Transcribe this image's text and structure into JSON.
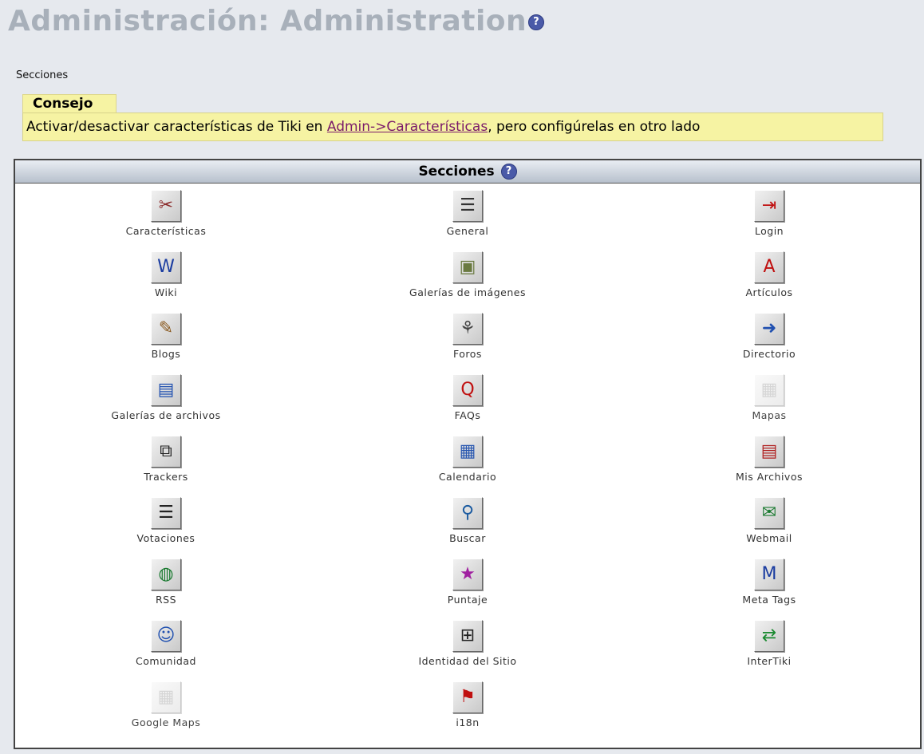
{
  "page": {
    "title": "Administración: Administration",
    "help_glyph": "?"
  },
  "breadcrumb": "Secciones",
  "tip": {
    "heading": "Consejo",
    "text_before": "Activar/desactivar características de Tiki en ",
    "link_text": "Admin->Características",
    "text_after": ", pero configúrelas en otro lado"
  },
  "panel": {
    "header": "Secciones",
    "help_glyph": "?",
    "items": [
      {
        "label": "Características",
        "icon": "features-icon",
        "glyph": "✂",
        "color": "#8a2a2a"
      },
      {
        "label": "General",
        "icon": "general-icon",
        "glyph": "☰",
        "color": "#333"
      },
      {
        "label": "Login",
        "icon": "login-icon",
        "glyph": "⇥",
        "color": "#c01010"
      },
      {
        "label": "Wiki",
        "icon": "wiki-icon",
        "glyph": "W",
        "color": "#1a3ca0"
      },
      {
        "label": "Galerías de imágenes",
        "icon": "image-gallery-icon",
        "glyph": "▣",
        "color": "#6a7a40"
      },
      {
        "label": "Artículos",
        "icon": "articles-icon",
        "glyph": "A",
        "color": "#c01010"
      },
      {
        "label": "Blogs",
        "icon": "blogs-icon",
        "glyph": "✎",
        "color": "#8a5a20"
      },
      {
        "label": "Foros",
        "icon": "forums-icon",
        "glyph": "⚘",
        "color": "#444"
      },
      {
        "label": "Directorio",
        "icon": "directory-icon",
        "glyph": "➜",
        "color": "#2050b0"
      },
      {
        "label": "Galerías de archivos",
        "icon": "file-gallery-icon",
        "glyph": "▤",
        "color": "#2050b0"
      },
      {
        "label": "FAQs",
        "icon": "faqs-icon",
        "glyph": "Q",
        "color": "#c01010"
      },
      {
        "label": "Mapas",
        "icon": "maps-icon",
        "glyph": "▦",
        "color": "#888",
        "faded": true
      },
      {
        "label": "Trackers",
        "icon": "trackers-icon",
        "glyph": "⧉",
        "color": "#222"
      },
      {
        "label": "Calendario",
        "icon": "calendar-icon",
        "glyph": "▦",
        "color": "#2a58b0"
      },
      {
        "label": "Mis Archivos",
        "icon": "my-files-icon",
        "glyph": "▤",
        "color": "#b02020"
      },
      {
        "label": "Votaciones",
        "icon": "polls-icon",
        "glyph": "☰",
        "color": "#222"
      },
      {
        "label": "Buscar",
        "icon": "search-icon",
        "glyph": "⚲",
        "color": "#1a5aa0"
      },
      {
        "label": "Webmail",
        "icon": "webmail-icon",
        "glyph": "✉",
        "color": "#1a7a30"
      },
      {
        "label": "RSS",
        "icon": "rss-icon",
        "glyph": "◍",
        "color": "#1a7a30"
      },
      {
        "label": "Puntaje",
        "icon": "score-icon",
        "glyph": "★",
        "color": "#a020a0"
      },
      {
        "label": "Meta Tags",
        "icon": "meta-tags-icon",
        "glyph": "M",
        "color": "#1a3ca0"
      },
      {
        "label": "Comunidad",
        "icon": "community-icon",
        "glyph": "☺",
        "color": "#2050b0"
      },
      {
        "label": "Identidad del Sitio",
        "icon": "site-identity-icon",
        "glyph": "⊞",
        "color": "#222"
      },
      {
        "label": "InterTiki",
        "icon": "intertiki-icon",
        "glyph": "⇄",
        "color": "#1a8a30"
      },
      {
        "label": "Google Maps",
        "icon": "google-maps-icon",
        "glyph": "▦",
        "color": "#888",
        "faded": true
      },
      {
        "label": "i18n",
        "icon": "i18n-icon",
        "glyph": "⚑",
        "color": "#c01010"
      }
    ]
  }
}
